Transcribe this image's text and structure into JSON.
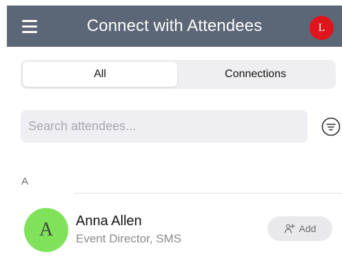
{
  "header": {
    "title": "Connect with Attendees",
    "profile_initial": "L",
    "bg_color": "#5b6677",
    "profile_color": "#e0141c",
    "menu_icon": "hamburger-icon"
  },
  "tabs": [
    {
      "label": "All",
      "selected": true
    },
    {
      "label": "Connections",
      "selected": false
    }
  ],
  "search": {
    "placeholder": "Search attendees...",
    "value": "",
    "filter_icon": "filter-icon"
  },
  "sections": [
    {
      "letter": "A",
      "attendees": [
        {
          "initial": "A",
          "name": "Anna Allen",
          "role": "Event Director, SMS",
          "avatar_color": "#80e25b",
          "action_label": "Add",
          "action_icon": "add-person-icon"
        }
      ]
    }
  ]
}
